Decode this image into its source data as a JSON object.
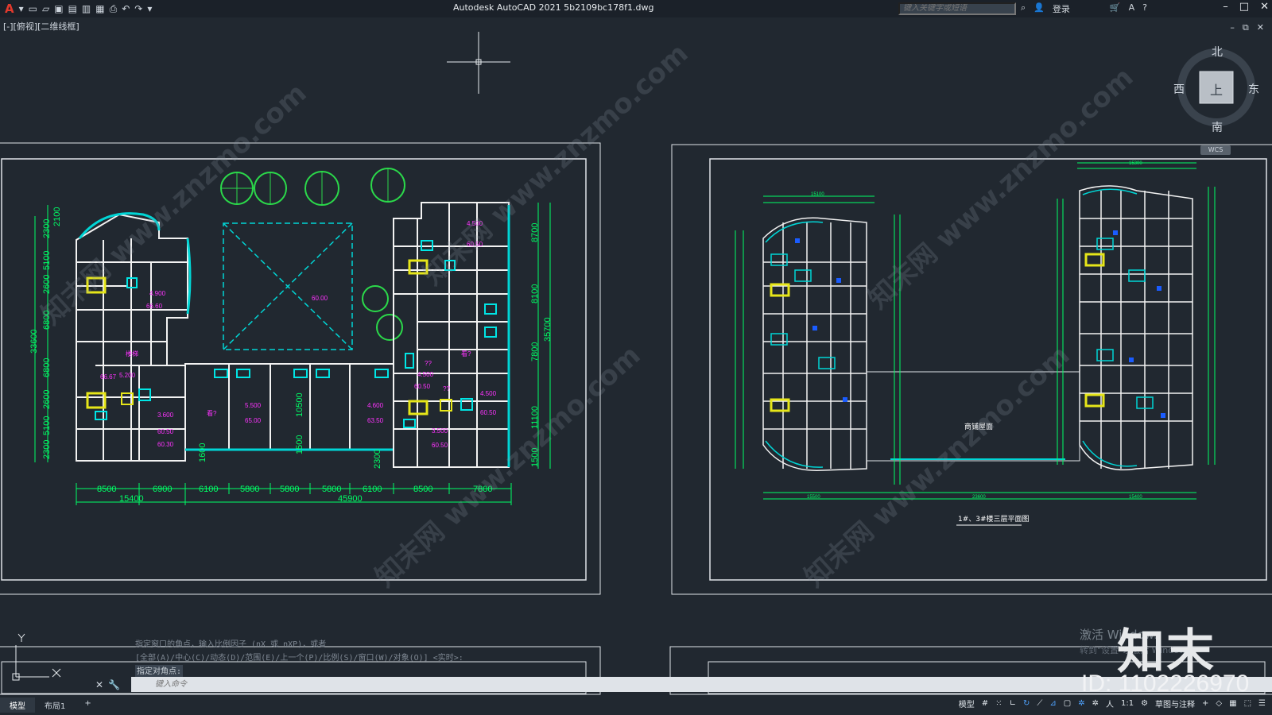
{
  "titlebar": {
    "app_title": "Autodesk AutoCAD 2021    5b2109bc178f1.dwg",
    "search_placeholder": "键入关键字或短语",
    "login": "登录"
  },
  "viewport_label": "[-][俯视][二维线框]",
  "viewcube": {
    "north": "北",
    "south": "南",
    "east": "东",
    "west": "西",
    "top": "上",
    "wcs": "WCS"
  },
  "left_plan": {
    "top_dims": [
      "8500",
      "6900",
      "6100",
      "5800",
      "5800",
      "5800",
      "6100",
      "8500",
      "7800"
    ],
    "bottom_dims": [
      "15400",
      "45900"
    ],
    "left_dims": [
      "2100",
      "2300",
      "5100",
      "2600",
      "6800",
      "6800",
      "2600",
      "5100",
      "2300"
    ],
    "left_total": "33600",
    "right_dims": [
      "8700",
      "8100",
      "7800",
      "11100",
      "1500"
    ],
    "right_total": "35700",
    "inner_dims": [
      "10500",
      "1600",
      "1500",
      "2300"
    ],
    "center_label": "60.00",
    "room_labels": [
      "4.500",
      "60.50",
      "4.900",
      "66.60",
      "5.500",
      "65.00",
      "4.600",
      "63.50",
      "3.600",
      "60.50",
      "4.500",
      "60.50",
      "3.500",
      "60.50",
      "4.500",
      "60.50",
      "5.200",
      "66.67",
      "60.30",
      "楼梯",
      "看?",
      "看?",
      "??",
      "??"
    ]
  },
  "right_plan": {
    "title": "1#、3#楼三层平面图",
    "center_label": "商铺屋面",
    "top_dims": [
      "15100",
      "15300"
    ],
    "bottom_dims": [
      "15500",
      "23600",
      "15400"
    ]
  },
  "command": {
    "history": [
      "指定窗口的角点，输入比例因子 (nX 或 nXP)，或者",
      "[全部(A)/中心(C)/动态(D)/范围(E)/上一个(P)/比例(S)/窗口(W)/对象(O)] <实时>:",
      "指定对角点:"
    ],
    "placeholder": "键入命令"
  },
  "tabs": [
    "模型",
    "布局1",
    "+"
  ],
  "statusbar": {
    "model": "模型",
    "scale": "1:1",
    "workspace": "草图与注释"
  },
  "overlay": {
    "activate": "激活 Windows",
    "activate_sub": "转到\"设置\"以激活 Windows。",
    "brand": "知末",
    "doc_id": "ID: 1102226970",
    "watermark": "知末网 www.znzmo.com"
  },
  "colors": {
    "background": "#212830",
    "dimension": "#00ff66",
    "wall": "#ffffff",
    "cyan": "#00e5e5",
    "magenta": "#ff33ff"
  }
}
